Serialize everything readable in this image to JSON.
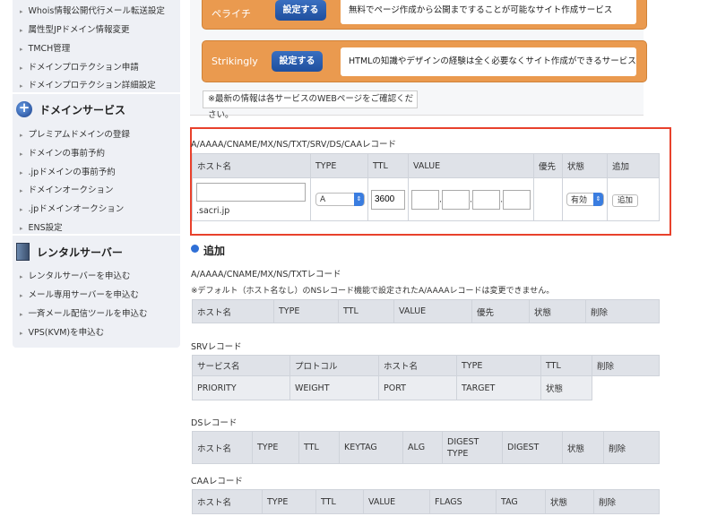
{
  "sidebar": {
    "top_items": [
      "Whois情報公開代行メール転送設定",
      "属性型JPドメイン情報変更",
      "TMCH管理",
      "ドメインプロテクション申請",
      "ドメインプロテクション詳細設定"
    ],
    "domain_service": {
      "title": "ドメインサービス",
      "icon": "globe-plus-icon",
      "items": [
        "プレミアムドメインの登録",
        "ドメインの事前予約",
        ".jpドメインの事前予約",
        "ドメインオークション",
        ".jpドメインオークション",
        "ENS設定"
      ]
    },
    "rental_server": {
      "title": "レンタルサーバー",
      "icon": "server-icon",
      "items": [
        "レンタルサーバーを申込む",
        "メール専用サーバーを申込む",
        "一斉メール配信ツールを申込む",
        "VPS(KVM)を申込む"
      ]
    }
  },
  "services": [
    {
      "name": "ペライチ",
      "button": "設定する",
      "description": "無料でページ作成から公開まですることが可能なサイト作成サービス"
    },
    {
      "name": "Strikingly",
      "button": "設定する",
      "description": "HTMLの知識やデザインの経験は全く必要なくサイト作成ができるサービス"
    }
  ],
  "notice": "※最新の情報は各サービスのWEBページをご確認ください。",
  "add_form": {
    "title": "A/AAAA/CNAME/MX/NS/TXT/SRV/DS/CAAレコード",
    "headers": [
      "ホスト名",
      "TYPE",
      "TTL",
      "VALUE",
      "優先",
      "状態",
      "追加"
    ],
    "host_value": "",
    "domain_suffix": ".sacri.jp",
    "type_value": "A",
    "ttl_value": "3600",
    "ip_parts": [
      "",
      "",
      "",
      ""
    ],
    "status_value": "有効",
    "add_button": "追加"
  },
  "records": {
    "heading": "追加",
    "a_section": {
      "title": "A/AAAA/CNAME/MX/NS/TXTレコード",
      "note": "※デフォルト（ホスト名なし）のNSレコード機能で設定されたA/AAAAレコードは変更できません。",
      "headers": [
        "ホスト名",
        "TYPE",
        "TTL",
        "VALUE",
        "優先",
        "状態",
        "削除"
      ]
    },
    "srv_section": {
      "title": "SRVレコード",
      "headers_row1": [
        "サービス名",
        "プロトコル",
        "ホスト名",
        "TYPE",
        "TTL",
        "削除"
      ],
      "headers_row2": [
        "PRIORITY",
        "WEIGHT",
        "PORT",
        "TARGET",
        "状態"
      ]
    },
    "ds_section": {
      "title": "DSレコード",
      "headers": [
        "ホスト名",
        "TYPE",
        "TTL",
        "KEYTAG",
        "ALG",
        "DIGEST TYPE",
        "DIGEST",
        "状態",
        "削除"
      ]
    },
    "caa_section": {
      "title": "CAAレコード",
      "headers": [
        "ホスト名",
        "TYPE",
        "TTL",
        "VALUE",
        "FLAGS",
        "TAG",
        "状態",
        "削除"
      ]
    }
  },
  "colors": {
    "service_box": "#ea9a4f",
    "button": "#2a5db0",
    "highlight_border": "#e8412c",
    "table_header": "#dfe2e8",
    "bullet": "#2f6fd6"
  }
}
